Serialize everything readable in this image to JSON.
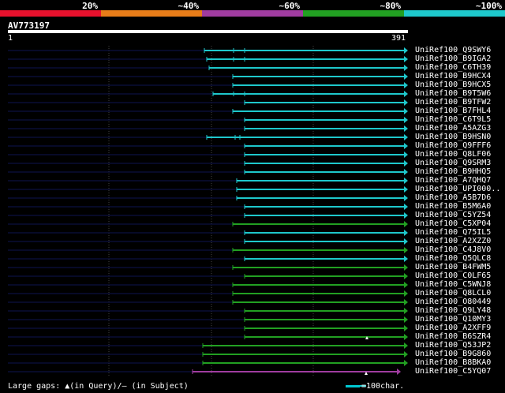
{
  "legend": {
    "labels": [
      "20%",
      "~40%",
      "~60%",
      "~80%",
      "~100%"
    ],
    "colors": [
      "#e8112d",
      "#e87d19",
      "#a03ca0",
      "#22a022",
      "#1ec8cc"
    ]
  },
  "query": {
    "id": "AV773197",
    "start": "1",
    "end": "391"
  },
  "hits": [
    {
      "name": "UniRef100_Q9SWY6",
      "color": "#1ec8cc"
    },
    {
      "name": "UniRef100_B9IGA2",
      "color": "#1ec8cc"
    },
    {
      "name": "UniRef100_C6TH39",
      "color": "#1ec8cc"
    },
    {
      "name": "UniRef100_B9HCX4",
      "color": "#1ec8cc"
    },
    {
      "name": "UniRef100_B9HCX5",
      "color": "#1ec8cc"
    },
    {
      "name": "UniRef100_B9T5W6",
      "color": "#1ec8cc"
    },
    {
      "name": "UniRef100_B9TFW2",
      "color": "#1ec8cc"
    },
    {
      "name": "UniRef100_B7FHL4",
      "color": "#1ec8cc"
    },
    {
      "name": "UniRef100_C6T9L5",
      "color": "#1ec8cc"
    },
    {
      "name": "UniRef100_A5AZG3",
      "color": "#1ec8cc"
    },
    {
      "name": "UniRef100_B9HSN0",
      "color": "#1ec8cc"
    },
    {
      "name": "UniRef100_Q9FFF6",
      "color": "#1ec8cc"
    },
    {
      "name": "UniRef100_Q8LF06",
      "color": "#1ec8cc"
    },
    {
      "name": "UniRef100_Q9SRM3",
      "color": "#1ec8cc"
    },
    {
      "name": "UniRef100_B9HHQ5",
      "color": "#1ec8cc"
    },
    {
      "name": "UniRef100_A7QHQ7",
      "color": "#1ec8cc"
    },
    {
      "name": "UniRef100_UPI000..",
      "color": "#1ec8cc"
    },
    {
      "name": "UniRef100_A5B7D6",
      "color": "#1ec8cc"
    },
    {
      "name": "UniRef100_B5M6A0",
      "color": "#1ec8cc"
    },
    {
      "name": "UniRef100_C5YZ54",
      "color": "#1ec8cc"
    },
    {
      "name": "UniRef100_C5XP04",
      "color": "#22a022"
    },
    {
      "name": "UniRef100_Q75IL5",
      "color": "#1ec8cc"
    },
    {
      "name": "UniRef100_A2XZZ0",
      "color": "#1ec8cc"
    },
    {
      "name": "UniRef100_C4J8V0",
      "color": "#22a022"
    },
    {
      "name": "UniRef100_Q5QLC8",
      "color": "#1ec8cc"
    },
    {
      "name": "UniRef100_B4FWM5",
      "color": "#22a022"
    },
    {
      "name": "UniRef100_C0LF65",
      "color": "#22a022"
    },
    {
      "name": "UniRef100_C5WNJ8",
      "color": "#22a022"
    },
    {
      "name": "UniRef100_Q8LCL0",
      "color": "#22a022"
    },
    {
      "name": "UniRef100_O80449",
      "color": "#22a022"
    },
    {
      "name": "UniRef100_Q9LY48",
      "color": "#22a022"
    },
    {
      "name": "UniRef100_Q10MY3",
      "color": "#22a022"
    },
    {
      "name": "UniRef100_A2XFF9",
      "color": "#22a022"
    },
    {
      "name": "UniRef100_B6SZR4",
      "color": "#22a022"
    },
    {
      "name": "UniRef100_Q53JP2",
      "color": "#22a022"
    },
    {
      "name": "UniRef100_B9G860",
      "color": "#22a022"
    },
    {
      "name": "UniRef100_B8BKA0",
      "color": "#22a022"
    },
    {
      "name": "UniRef100_C5YQ07",
      "color": "#a03ca0"
    }
  ],
  "footer": {
    "gaps_text": "Large gaps: ▲(in Query)/— (in Subject)",
    "scale_text": "=100char."
  }
}
